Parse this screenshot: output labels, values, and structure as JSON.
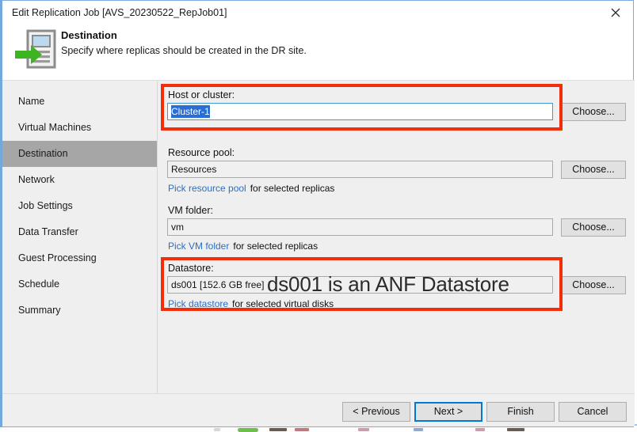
{
  "window": {
    "title": "Edit Replication Job [AVS_20230522_RepJob01]",
    "close_icon": "close-icon"
  },
  "header": {
    "icon": "replication-destination-icon",
    "title": "Destination",
    "subtitle": "Specify where replicas should be created in the DR site."
  },
  "sidebar": {
    "items": [
      {
        "label": "Name",
        "selected": false
      },
      {
        "label": "Virtual Machines",
        "selected": false
      },
      {
        "label": "Destination",
        "selected": true
      },
      {
        "label": "Network",
        "selected": false
      },
      {
        "label": "Job Settings",
        "selected": false
      },
      {
        "label": "Data Transfer",
        "selected": false
      },
      {
        "label": "Guest Processing",
        "selected": false
      },
      {
        "label": "Schedule",
        "selected": false
      },
      {
        "label": "Summary",
        "selected": false
      }
    ]
  },
  "form": {
    "host_or_cluster": {
      "label": "Host or cluster:",
      "value": "Cluster-1",
      "choose_label": "Choose...",
      "highlighted": true
    },
    "resource_pool": {
      "label": "Resource pool:",
      "value": "Resources",
      "choose_label": "Choose...",
      "hint_link": "Pick resource pool",
      "hint_rest": "for selected replicas"
    },
    "vm_folder": {
      "label": "VM folder:",
      "value": "vm",
      "choose_label": "Choose...",
      "hint_link": "Pick VM folder",
      "hint_rest": "for selected replicas"
    },
    "datastore": {
      "label": "Datastore:",
      "value": "ds001 [152.6 GB free]",
      "choose_label": "Choose...",
      "hint_link": "Pick datastore",
      "hint_rest": "for selected virtual disks",
      "highlighted": true
    }
  },
  "annotation": {
    "text": "ds001 is an ANF Datastore",
    "box_color": "#f42c0a"
  },
  "footer": {
    "previous_label": "< Previous",
    "next_label": "Next >",
    "finish_label": "Finish",
    "cancel_label": "Cancel"
  },
  "colors": {
    "selection_blue": "#2a6ed4",
    "focus_blue": "#0078d7",
    "link_blue": "#2b6fc4",
    "annotation_red": "#f42c0a",
    "window_border": "#7aacdd",
    "nav_selected": "#a6a6a6"
  }
}
